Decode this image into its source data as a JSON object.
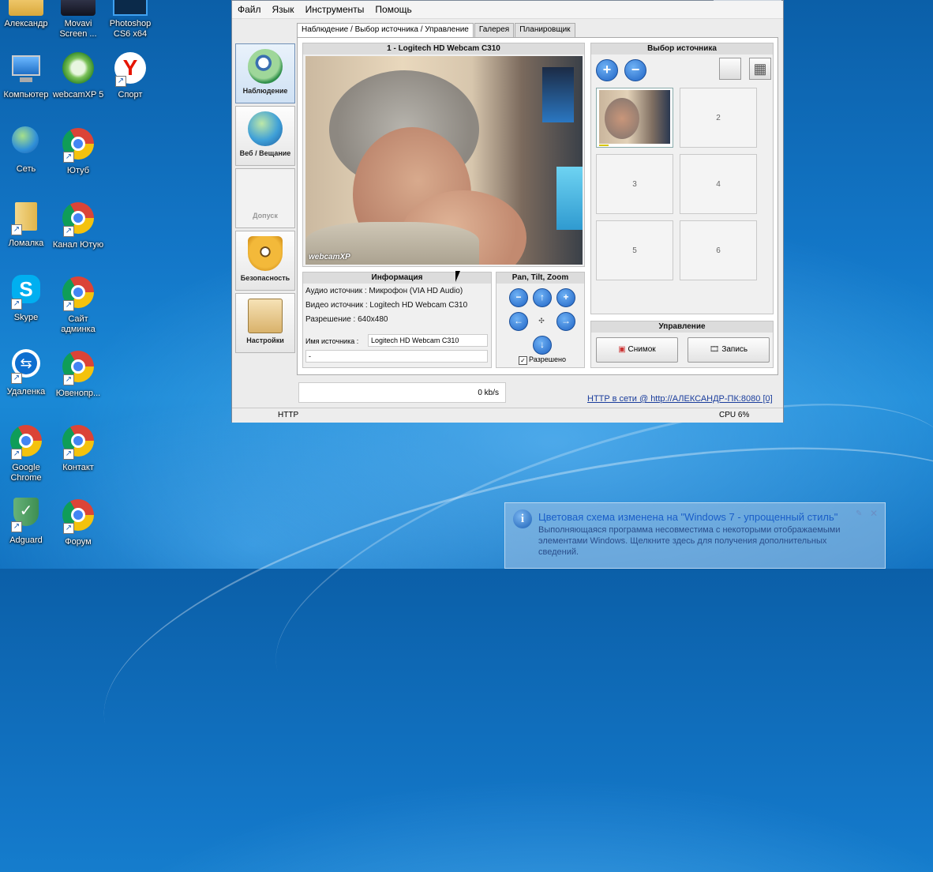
{
  "desktop": {
    "icons": [
      {
        "label": "Александр"
      },
      {
        "label": "Movavi Screen ..."
      },
      {
        "label": "Photoshop CS6 x64"
      },
      {
        "label": "Компьютер"
      },
      {
        "label": "webcamXP 5"
      },
      {
        "label": "Спорт"
      },
      {
        "label": "Сеть"
      },
      {
        "label": "Ютуб"
      },
      {
        "label": "Ломалка"
      },
      {
        "label": "Канал Ютую"
      },
      {
        "label": "Skype"
      },
      {
        "label": "Сайт админка"
      },
      {
        "label": "Удаленка"
      },
      {
        "label": "Ювенопр..."
      },
      {
        "label": "Google Chrome"
      },
      {
        "label": "Контакт"
      },
      {
        "label": "Adguard"
      },
      {
        "label": "Форум"
      }
    ]
  },
  "window": {
    "menu": [
      "Файл",
      "Язык",
      "Инструменты",
      "Помощь"
    ],
    "sidebar": [
      {
        "label": "Наблюдение"
      },
      {
        "label": "Веб / Вещание"
      },
      {
        "label": "Допуск"
      },
      {
        "label": "Безопасность"
      },
      {
        "label": "Настройки"
      }
    ],
    "tabs": [
      "Наблюдение / Выбор источника / Управление",
      "Галерея",
      "Планировщик"
    ],
    "video": {
      "title": "1 - Logitech HD Webcam C310",
      "watermark": "webcamXP"
    },
    "info": {
      "title": "Информация",
      "audio": "Аудио источник : Микрофон (VIA HD Audio)",
      "video": "Видео источник : Logitech HD Webcam C310",
      "resolution": "Разрешение : 640x480",
      "name_label": "Имя источника :",
      "name_value": "Logitech HD Webcam C310",
      "extra": "-"
    },
    "ptz": {
      "title": "Pan, Tilt, Zoom",
      "allow_label": "Разрешено",
      "allow_checked": true
    },
    "source": {
      "title": "Выбор источника",
      "tiles": [
        "2",
        "3",
        "4",
        "5",
        "6"
      ]
    },
    "control": {
      "title": "Управление",
      "snapshot": "Снимок",
      "record": "Запись"
    },
    "rate": "0 kb/s",
    "link": "HTTP в сети @ http://АЛЕКСАНДР-ПК:8080 [0]",
    "status": {
      "protocol": "HTTP",
      "cpu": "CPU 6%"
    }
  },
  "notification": {
    "title": "Цветовая схема изменена на \"Windows 7 - упрощенный стиль\"",
    "body": "Выполняющаяся программа несовместима с некоторыми отображаемыми элементами Windows.  Щелкните здесь для получения дополнительных сведений."
  }
}
